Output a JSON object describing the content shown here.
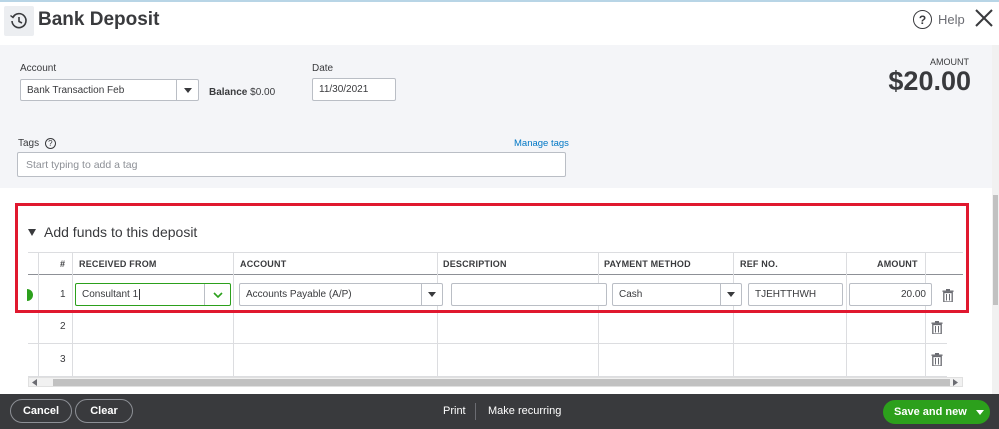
{
  "header": {
    "title": "Bank Deposit",
    "help_label": "Help",
    "help_glyph": "?",
    "history_icon": "history-clock-icon",
    "close_icon": "close-icon"
  },
  "form": {
    "account_label": "Account",
    "account_value": "Bank Transaction Feb",
    "balance_label": "Balance",
    "balance_value": "$0.00",
    "date_label": "Date",
    "date_value": "11/30/2021",
    "amount_label": "AMOUNT",
    "amount_value": "$20.00",
    "tags_label": "Tags",
    "tags_help_glyph": "?",
    "manage_tags": "Manage tags",
    "tags_placeholder": "Start typing to add a tag"
  },
  "funds": {
    "title": "Add funds to this deposit",
    "columns": [
      "#",
      "RECEIVED FROM",
      "ACCOUNT",
      "DESCRIPTION",
      "PAYMENT METHOD",
      "REF NO.",
      "AMOUNT"
    ],
    "rows": [
      {
        "num": "1",
        "received_from": "Consultant 1",
        "account": "Accounts Payable (A/P)",
        "description": "",
        "payment_method": "Cash",
        "ref_no": "TJEHTTHWH",
        "amount": "20.00"
      },
      {
        "num": "2"
      },
      {
        "num": "3"
      }
    ]
  },
  "footer": {
    "cancel": "Cancel",
    "clear": "Clear",
    "print": "Print",
    "make_recurring": "Make recurring",
    "save_and_new": "Save and new"
  },
  "colors": {
    "accent_green": "#2ca01c",
    "highlight_red": "#e0182f",
    "link_blue": "#0077c5",
    "footer_bg": "#393a3d"
  }
}
